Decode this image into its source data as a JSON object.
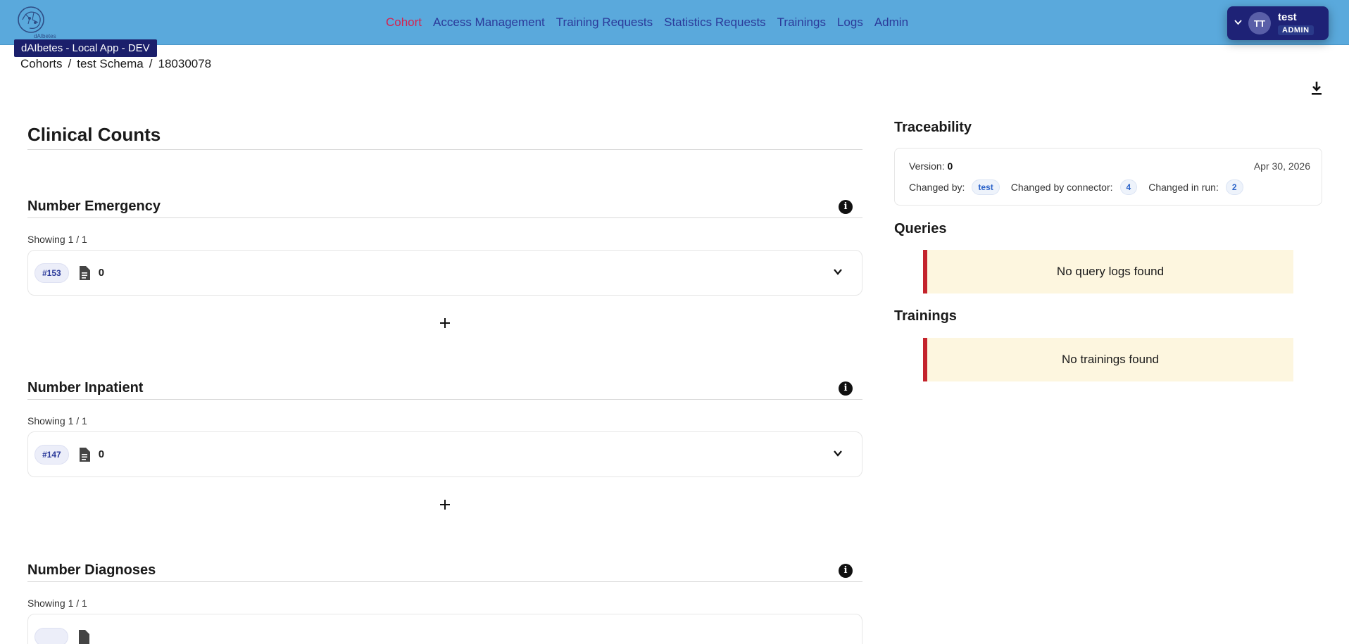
{
  "app": {
    "env_badge": "dAIbetes - Local App - DEV",
    "logo_text": "dAIbetes"
  },
  "nav": {
    "items": [
      {
        "label": "Cohort",
        "active": true
      },
      {
        "label": "Access Management"
      },
      {
        "label": "Training Requests"
      },
      {
        "label": "Statistics Requests"
      },
      {
        "label": "Trainings"
      },
      {
        "label": "Logs"
      },
      {
        "label": "Admin"
      }
    ]
  },
  "user": {
    "initials": "TT",
    "name": "test",
    "role": "ADMIN"
  },
  "breadcrumb": [
    "Cohorts",
    "test Schema",
    "18030078"
  ],
  "page": {
    "title": "Clinical Counts"
  },
  "sections": [
    {
      "title": "Number Emergency",
      "showing": "Showing 1 / 1",
      "id": "#153",
      "value": "0"
    },
    {
      "title": "Number Inpatient",
      "showing": "Showing 1 / 1",
      "id": "#147",
      "value": "0"
    },
    {
      "title": "Number Diagnoses",
      "showing": "Showing 1 / 1",
      "id": "",
      "value": ""
    }
  ],
  "traceability": {
    "title": "Traceability",
    "version_label": "Version:",
    "version": "0",
    "date": "Apr 30, 2026",
    "changed_by_label": "Changed by:",
    "changed_by": "test",
    "connector_label": "Changed by connector:",
    "connector": "4",
    "run_label": "Changed in run:",
    "run": "2"
  },
  "queries": {
    "title": "Queries",
    "empty": "No query logs found"
  },
  "trainings": {
    "title": "Trainings",
    "empty": "No trainings found"
  },
  "colors": {
    "topbar": "#5aa9dc",
    "nav": "#2b3a9a",
    "nav_active": "#d6224f",
    "user_menu": "#1e2276",
    "warning_bg": "#fdf6df",
    "warning_border": "#c4232c"
  }
}
